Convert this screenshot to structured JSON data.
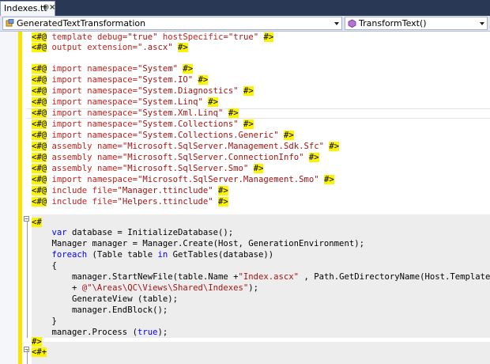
{
  "tab": {
    "title": "Indexes.tt",
    "pin_glyph": "⊕",
    "close_glyph": "×"
  },
  "navbar": {
    "left_dropdown": "GeneratedTextTransformation",
    "right_dropdown": "TransformText()"
  },
  "colors": {
    "directive_highlight": "#fbf300",
    "directive_keyword": "#c4221f",
    "string": "#a31515",
    "csharp_keyword": "#0000ff",
    "code_block_background": "#ededee",
    "change_bar": "#f7e400",
    "ide_background": "#293955"
  },
  "directives": [
    {
      "open": "<#@",
      "kw": "template",
      "a1": "debug=",
      "s1": "\"true\"",
      "a2": "hostSpecific=",
      "s2": "\"true\"",
      "close": "#>"
    },
    {
      "open": "<#@",
      "kw": "output",
      "a1": "extension=",
      "s1": "\".ascx\"",
      "close": "#>"
    },
    {
      "open": "<#@",
      "kw": "import",
      "a1": "namespace=",
      "s1": "\"System\"",
      "close": "#>"
    },
    {
      "open": "<#@",
      "kw": "import",
      "a1": "namespace=",
      "s1": "\"System.IO\"",
      "close": "#>"
    },
    {
      "open": "<#@",
      "kw": "import",
      "a1": "namespace=",
      "s1": "\"System.Diagnostics\"",
      "close": "#>"
    },
    {
      "open": "<#@",
      "kw": "import",
      "a1": "namespace=",
      "s1": "\"System.Linq\"",
      "close": "#>"
    },
    {
      "open": "<#@",
      "kw": "import",
      "a1": "namespace=",
      "s1": "\"System.Xml.Linq\"",
      "close": "#>"
    },
    {
      "open": "<#@",
      "kw": "import",
      "a1": "namespace=",
      "s1": "\"System.Collections\"",
      "close": "#>"
    },
    {
      "open": "<#@",
      "kw": "import",
      "a1": "namespace=",
      "s1": "\"System.Collections.Generic\"",
      "close": "#>"
    },
    {
      "open": "<#@",
      "kw": "assembly",
      "a1": "name=",
      "s1": "\"Microsoft.SqlServer.Management.Sdk.Sfc\"",
      "close": "#>"
    },
    {
      "open": "<#@",
      "kw": "assembly",
      "a1": "name=",
      "s1": "\"Microsoft.SqlServer.ConnectionInfo\"",
      "close": "#>"
    },
    {
      "open": "<#@",
      "kw": "assembly",
      "a1": "name=",
      "s1": "\"Microsoft.SqlServer.Smo\"",
      "close": "#>"
    },
    {
      "open": "<#@",
      "kw": "import",
      "a1": "namespace=",
      "s1": "\"Microsoft.SqlServer.Management.Smo\"",
      "close": "#>"
    },
    {
      "open": "<#@",
      "kw": "include",
      "a1": "file=",
      "s1": "\"Manager.ttinclude\"",
      "close": "#>"
    },
    {
      "open": "<#@",
      "kw": "include",
      "a1": "file=",
      "s1": "\"Helpers.ttinclude\"",
      "close": "#>"
    }
  ],
  "code_block": {
    "open": "<#",
    "close": "#>",
    "line1": {
      "kw": "var",
      "rest": " database = InitializeDatabase();"
    },
    "line2": "Manager manager = Manager.Create(Host, GenerationEnvironment);",
    "line3": {
      "kw": "foreach",
      "a": " (Table table ",
      "kw2": "in",
      "b": " GetTables(database))"
    },
    "line4": "{",
    "line5": {
      "a": "manager.StartNewFile(table.Name +",
      "s": "\"Index.ascx\"",
      "b": " , Path.GetDirectoryName(Host.TemplateFile)"
    },
    "line6": {
      "a": "+ ",
      "s": "@\"\\Areas\\QC\\Views\\Shared\\Indexes\"",
      "b": ");"
    },
    "line7": "GenerateView (table);",
    "line8": "manager.EndBlock();",
    "line9": "}",
    "line10": {
      "a": "manager.Process (",
      "kw": "true",
      "b": ");"
    }
  },
  "feature_block": {
    "open": "<#+"
  }
}
